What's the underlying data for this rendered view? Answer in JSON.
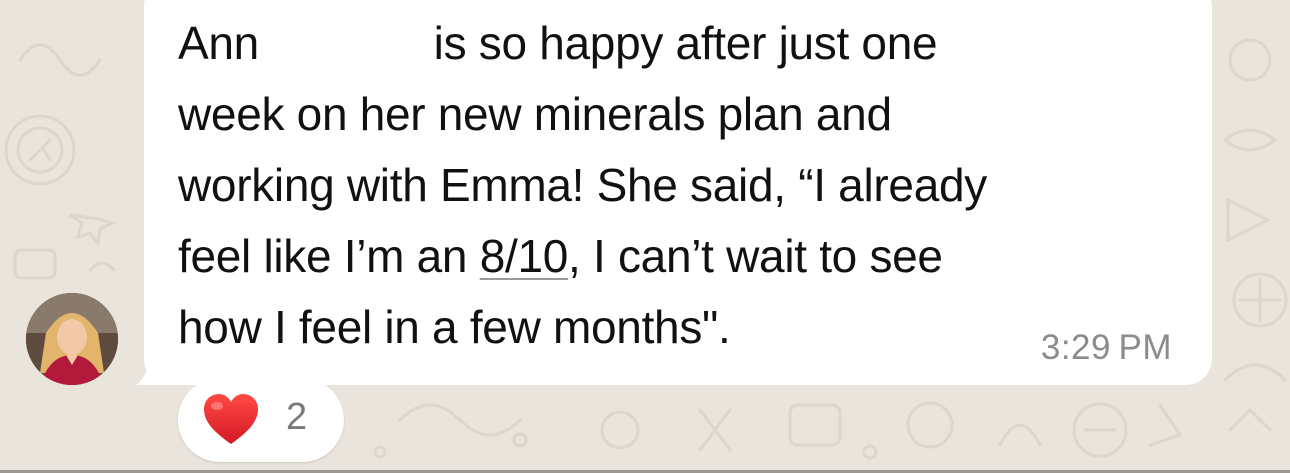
{
  "message": {
    "lines": [
      "Ann              is so happy after just one",
      "week on her new minerals plan and",
      "working with Emma! She said, “I already",
      "how I feel in a few months\"."
    ],
    "line4_pre": "feel like I’m an ",
    "line4_underlined": "8/10",
    "line4_post": ", I can’t wait to see",
    "timestamp": "3:29 PM"
  },
  "reaction": {
    "emoji_icon": "red-heart-icon",
    "count": "2"
  },
  "colors": {
    "chat_background": "#e9e4dc",
    "bubble": "#ffffff",
    "heart": "#e0242c"
  }
}
